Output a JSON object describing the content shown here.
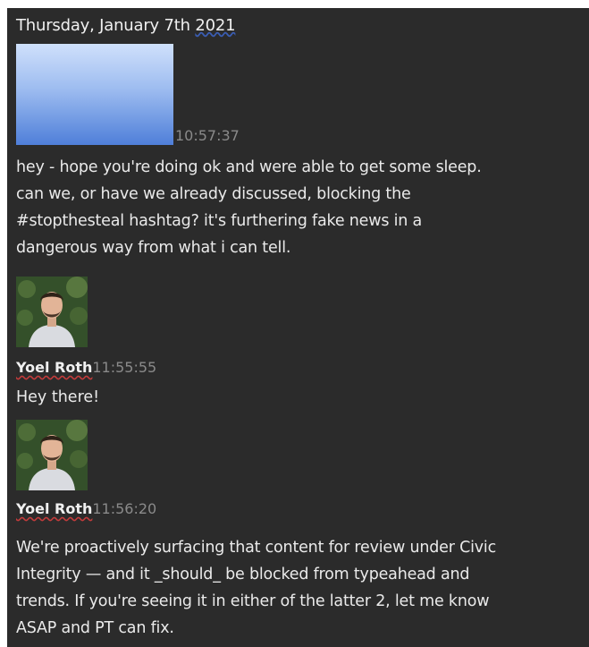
{
  "conversation": {
    "date_header": "Thursday, January 7th",
    "date_year": "2021",
    "messages": [
      {
        "timestamp": "10:57:37",
        "lines": [
          "hey - hope you're doing ok and were able to get some sleep.",
          "can we, or have we already discussed, blocking the",
          "#stopthesteal hashtag? it's furthering fake news in a",
          "dangerous way from what i can tell."
        ]
      },
      {
        "sender": "Yoel Roth",
        "timestamp": "11:55:55",
        "text": "Hey there!"
      },
      {
        "sender": "Yoel Roth",
        "timestamp": "11:56:20",
        "lines": [
          "We're proactively surfacing that content for review under Civic",
          "Integrity — and it _should_ be blocked from typeahead and",
          "trends. If you're seeing it in either of the latter 2, let me know",
          "ASAP and PT can fix."
        ]
      }
    ]
  },
  "colors": {
    "panel_bg": "#2b2b2b",
    "text": "#eaeaea",
    "timestamp": "#8a8a8a",
    "redaction_blue": "#4f7fd9"
  }
}
